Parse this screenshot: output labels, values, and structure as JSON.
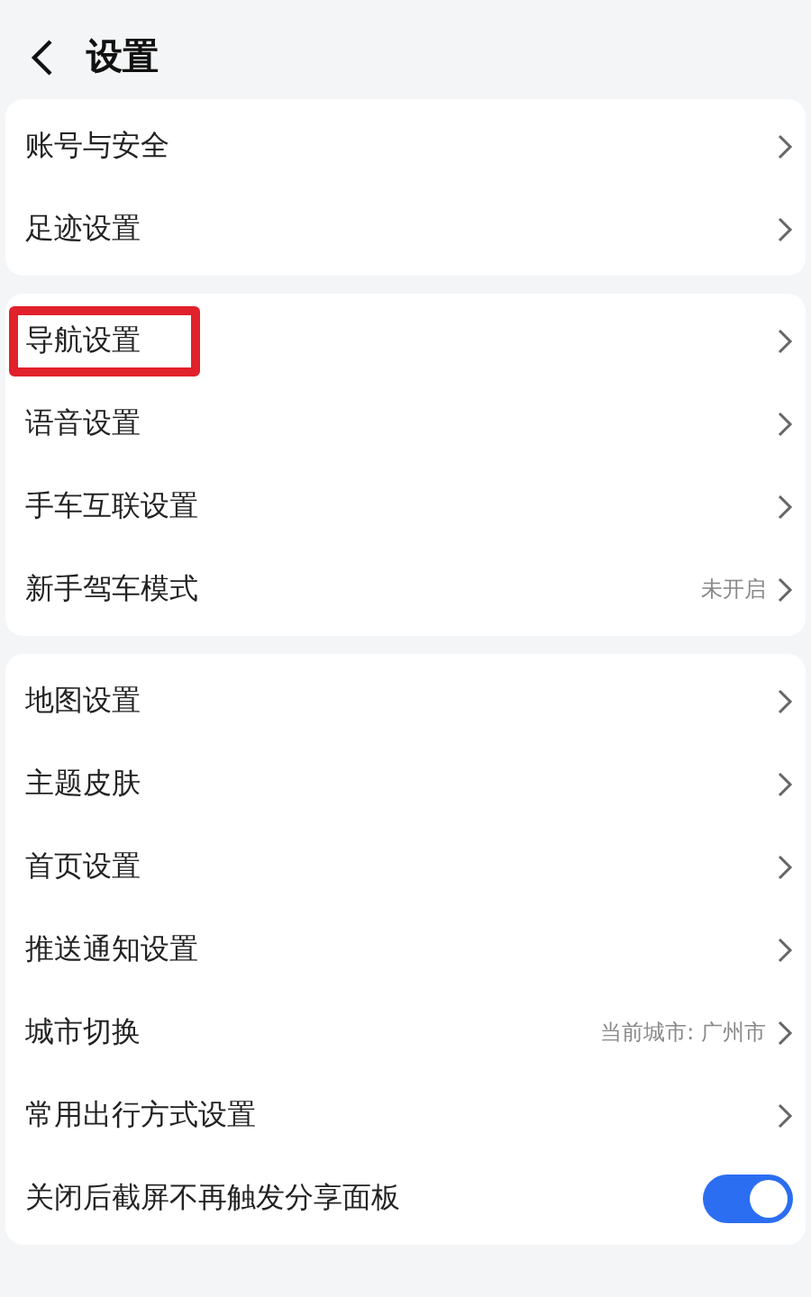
{
  "header": {
    "title": "设置"
  },
  "groups": [
    {
      "items": [
        {
          "label": "账号与安全",
          "kind": "link",
          "highlighted": false
        },
        {
          "label": "足迹设置",
          "kind": "link",
          "highlighted": false
        }
      ]
    },
    {
      "items": [
        {
          "label": "导航设置",
          "kind": "link",
          "highlighted": true
        },
        {
          "label": "语音设置",
          "kind": "link",
          "highlighted": false
        },
        {
          "label": "手车互联设置",
          "kind": "link",
          "highlighted": false
        },
        {
          "label": "新手驾车模式",
          "kind": "link",
          "value": "未开启",
          "highlighted": false
        }
      ]
    },
    {
      "items": [
        {
          "label": "地图设置",
          "kind": "link",
          "highlighted": false
        },
        {
          "label": "主题皮肤",
          "kind": "link",
          "highlighted": false
        },
        {
          "label": "首页设置",
          "kind": "link",
          "highlighted": false
        },
        {
          "label": "推送通知设置",
          "kind": "link",
          "highlighted": false
        },
        {
          "label": "城市切换",
          "kind": "link",
          "value": "当前城市: 广州市",
          "highlighted": false
        },
        {
          "label": "常用出行方式设置",
          "kind": "link",
          "highlighted": false
        },
        {
          "label": "关闭后截屏不再触发分享面板",
          "kind": "toggle",
          "on": true,
          "highlighted": false
        }
      ]
    }
  ]
}
